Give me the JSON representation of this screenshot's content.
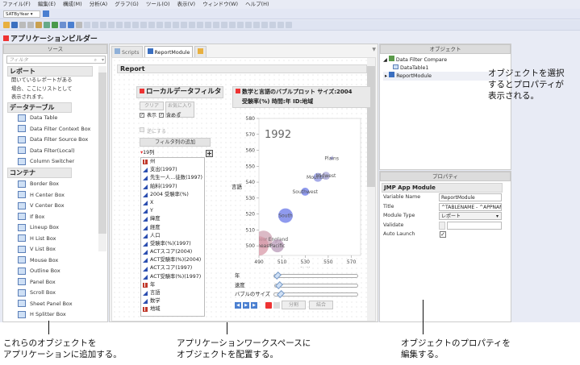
{
  "menu": [
    "ファイル(F)",
    "編集(E)",
    "構成(M)",
    "分析(A)",
    "グラフ(G)",
    "ツール(O)",
    "表示(V)",
    "ウィンドウ(W)",
    "ヘルプ(H)"
  ],
  "toolbar": {
    "table_select": "SATByYear"
  },
  "app_title": "アプリケーションビルダー",
  "source": {
    "header": "ソース",
    "filter_placeholder": "フィルタ",
    "sections": {
      "report": "レポート",
      "report_desc": [
        "開いているレポートがある",
        "場合、ここにリストとして",
        "表示されます。"
      ],
      "datatable": "データテーブル",
      "container": "コンテナ"
    },
    "datatable_items": [
      "Data Table",
      "Data Filter Context Box",
      "Data Filter Source Box",
      "Data Filter(Local)",
      "Column Switcher"
    ],
    "container_items": [
      "Border Box",
      "H Center Box",
      "V Center Box",
      "If Box",
      "Lineup Box",
      "H List Box",
      "V List Box",
      "Mouse Box",
      "Outline Box",
      "Panel Box",
      "Scroll Box",
      "Sheet Panel Box",
      "H Splitter Box"
    ]
  },
  "tabs": [
    "Scripts",
    "ReportModule"
  ],
  "report": {
    "title": "Report"
  },
  "filter": {
    "title": "ローカルデータフィルタ",
    "clear": "クリア",
    "favorites": "お気に入り",
    "show": "表示",
    "include": "含める",
    "invert": "逆にする",
    "add_columns": "フィルタ列の追加",
    "count": "19列",
    "columns": [
      {
        "name": "州",
        "type": "nominal"
      },
      {
        "name": "支出(1997)",
        "type": "continuous"
      },
      {
        "name": "先生一人…徒数(1997)",
        "type": "continuous"
      },
      {
        "name": "給料(1997)",
        "type": "continuous"
      },
      {
        "name": "2004 受験率(%)",
        "type": "continuous"
      },
      {
        "name": "X",
        "type": "continuous"
      },
      {
        "name": "Y",
        "type": "continuous"
      },
      {
        "name": "緯度",
        "type": "continuous"
      },
      {
        "name": "経度",
        "type": "continuous"
      },
      {
        "name": "人口",
        "type": "continuous"
      },
      {
        "name": "受験率(%)(1997)",
        "type": "continuous"
      },
      {
        "name": "ACTスコア(2004)",
        "type": "continuous"
      },
      {
        "name": "ACT受験率(%)(2004)",
        "type": "continuous"
      },
      {
        "name": "ACTスコア(1997)",
        "type": "continuous"
      },
      {
        "name": "ACT受験率(%)(1997)",
        "type": "continuous"
      },
      {
        "name": "年",
        "type": "nominal"
      },
      {
        "name": "言語",
        "type": "continuous"
      },
      {
        "name": "数学",
        "type": "continuous"
      },
      {
        "name": "地域",
        "type": "nominal"
      }
    ]
  },
  "bubble": {
    "title_line1": "数学と言語のバブルプロット サイズ:2004",
    "title_line2": "受験率(%) 時間:年  ID:地域",
    "sliders": {
      "year": "年",
      "speed": "速度",
      "size": "バブルのサイズ"
    },
    "split": "分割",
    "combine": "結合"
  },
  "chart_data": {
    "type": "scatter",
    "title": "1992",
    "xlabel": "数学",
    "ylabel": "言語",
    "xlim": [
      490,
      578
    ],
    "ylim": [
      494,
      580
    ],
    "xticks": [
      490,
      510,
      530,
      550,
      570
    ],
    "yticks": [
      500,
      510,
      520,
      530,
      540,
      550,
      560,
      570,
      580
    ],
    "points": [
      {
        "label": "South",
        "x": 513,
        "y": 519,
        "size": 9,
        "color": "#6a78e8"
      },
      {
        "label": "Southwest",
        "x": 530,
        "y": 534,
        "size": 5,
        "color": "#6a78e8"
      },
      {
        "label": "Mountain",
        "x": 541,
        "y": 543,
        "size": 5.5,
        "color": "#8a90e0"
      },
      {
        "label": "Midwest",
        "x": 548,
        "y": 544,
        "size": 5,
        "color": "#a8a6d8"
      },
      {
        "label": "Plains",
        "x": 553,
        "y": 555,
        "size": 2,
        "color": "#9a9ae0"
      },
      {
        "label": "New England",
        "x": 494,
        "y": 504,
        "size": 11,
        "color": "#cfa3b3"
      },
      {
        "label": "Pacific",
        "x": 506,
        "y": 500,
        "size": 8,
        "color": "#b89ab8"
      },
      {
        "label": "Northeast",
        "x": 490,
        "y": 500,
        "size": 12,
        "color": "#d89aa8"
      }
    ]
  },
  "objects": {
    "header": "オブジェクト",
    "tree": [
      "Data Filter Compare",
      "DataTable1",
      "ReportModule"
    ]
  },
  "properties": {
    "header": "プロパティ",
    "section": "JMP App Module",
    "rows": [
      {
        "label": "Variable Name",
        "value": "ReportModule"
      },
      {
        "label": "Title",
        "value": "^TABLENAME - ^APPNAME"
      },
      {
        "label": "Module Type",
        "value": "レポート"
      },
      {
        "label": "Validate",
        "value": ""
      },
      {
        "label": "Auto Launch",
        "value": "checked"
      }
    ]
  },
  "annotations": {
    "top_right": [
      "オブジェクトを選択",
      "するとプロパティが",
      "表示される。"
    ],
    "left": [
      "これらのオブジェクトを",
      "アプリケーションに追加する。"
    ],
    "center": [
      "アプリケーションワークスペースに",
      "オブジェクトを配置する。"
    ],
    "right": [
      "オブジェクトのプロパティを",
      "編集する。"
    ]
  }
}
